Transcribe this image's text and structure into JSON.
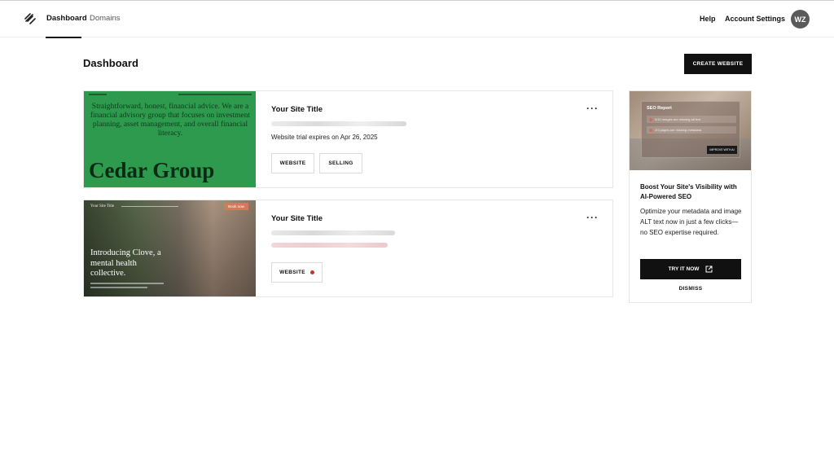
{
  "nav": {
    "tabs": [
      "Dashboard",
      "Domains"
    ],
    "help": "Help",
    "account_settings": "Account Settings",
    "avatar_initials": "WZ"
  },
  "page": {
    "title": "Dashboard",
    "create_button": "CREATE WEBSITE"
  },
  "sites": [
    {
      "title": "Your Site Title",
      "trial_text": "Website trial expires on Apr 26, 2025",
      "buttons": [
        "WEBSITE",
        "SELLING"
      ],
      "thumb": {
        "tagline": "Straightforward, honest, financial advice. We are a financial advisory group that focuses on investment planning, asset management, and overall financial literacy.",
        "brand": "Cedar Group",
        "bg_color": "#2e9a4e"
      }
    },
    {
      "title": "Your Site Title",
      "buttons": [
        "WEBSITE"
      ],
      "thumb": {
        "header_title": "Your Site Title",
        "headline": "Introducing Clove, a mental health collective.",
        "cta": "Book now"
      }
    }
  ],
  "promo": {
    "report_title": "SEO Report",
    "report_lines": [
      "5/10 images are missing alt text",
      "2/3 pages are missing metadata"
    ],
    "report_button": "IMPROVE WITH AI",
    "title": "Boost Your Site's Visibility with AI-Powered SEO",
    "body": "Optimize your metadata and image ALT text now in just a few clicks—no SEO expertise required.",
    "try_button": "TRY IT NOW",
    "dismiss": "DISMISS"
  },
  "colors": {
    "accent": "#111111",
    "thumb_green": "#2e9a4e",
    "alert_red": "#c8312c"
  },
  "icons": {
    "logo": "squarespace-logo-icon",
    "more": "more-horizontal-icon",
    "external": "external-link-icon"
  }
}
